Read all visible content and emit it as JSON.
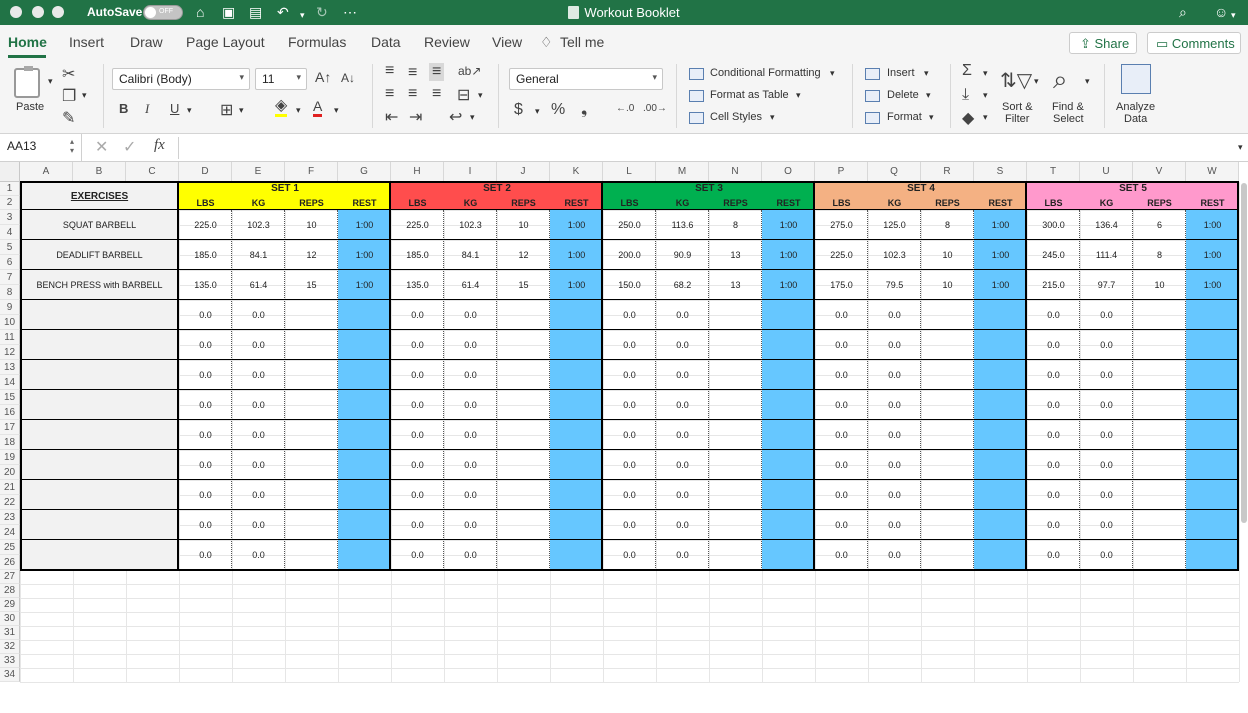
{
  "title_bar": {
    "autosave_label": "AutoSave",
    "autosave_state": "OFF",
    "document_title": "Workout Booklet"
  },
  "tabs": [
    {
      "label": "Home",
      "active": true
    },
    {
      "label": "Insert"
    },
    {
      "label": "Draw"
    },
    {
      "label": "Page Layout"
    },
    {
      "label": "Formulas"
    },
    {
      "label": "Data"
    },
    {
      "label": "Review"
    },
    {
      "label": "View"
    }
  ],
  "tell_me": "Tell me",
  "share_label": "Share",
  "comments_label": "Comments",
  "ribbon": {
    "paste": "Paste",
    "font_name": "Calibri (Body)",
    "font_size": "11",
    "number_format": "General",
    "conditional_formatting": "Conditional Formatting",
    "format_as_table": "Format as Table",
    "cell_styles": "Cell Styles",
    "insert": "Insert",
    "delete": "Delete",
    "format": "Format",
    "sort_filter_1": "Sort &",
    "sort_filter_2": "Filter",
    "find_select_1": "Find &",
    "find_select_2": "Select",
    "analyze_data_1": "Analyze",
    "analyze_data_2": "Data"
  },
  "formula_bar": {
    "cell_ref": "AA13",
    "fx": "fx",
    "value": ""
  },
  "columns": [
    "A",
    "B",
    "C",
    "D",
    "E",
    "F",
    "G",
    "H",
    "I",
    "J",
    "K",
    "L",
    "M",
    "N",
    "O",
    "P",
    "Q",
    "R",
    "S",
    "T",
    "U",
    "V",
    "W"
  ],
  "rows": [
    "1",
    "2",
    "3",
    "4",
    "5",
    "6",
    "7",
    "8",
    "9",
    "10",
    "11",
    "12",
    "13",
    "14",
    "15",
    "16",
    "17",
    "18",
    "19",
    "20",
    "21",
    "22",
    "23",
    "24",
    "25",
    "26",
    "27",
    "28",
    "29",
    "30",
    "31",
    "32",
    "33",
    "34"
  ],
  "exercises_header": "EXERCISES",
  "sets": [
    {
      "title": "SET 1",
      "color": "#ffff00"
    },
    {
      "title": "SET 2",
      "color": "#ff4d4d"
    },
    {
      "title": "SET 3",
      "color": "#00b050"
    },
    {
      "title": "SET 4",
      "color": "#f4b183"
    },
    {
      "title": "SET 5",
      "color": "#ff99cc"
    }
  ],
  "sub_headers": [
    "LBS",
    "KG",
    "REPS",
    "REST"
  ],
  "rest_color": "#66c7ff",
  "exercises": [
    {
      "name": "SQUAT BARBELL",
      "sets": [
        [
          "225.0",
          "102.3",
          "10",
          "1:00"
        ],
        [
          "225.0",
          "102.3",
          "10",
          "1:00"
        ],
        [
          "250.0",
          "113.6",
          "8",
          "1:00"
        ],
        [
          "275.0",
          "125.0",
          "8",
          "1:00"
        ],
        [
          "300.0",
          "136.4",
          "6",
          "1:00"
        ]
      ]
    },
    {
      "name": "DEADLIFT BARBELL",
      "sets": [
        [
          "185.0",
          "84.1",
          "12",
          "1:00"
        ],
        [
          "185.0",
          "84.1",
          "12",
          "1:00"
        ],
        [
          "200.0",
          "90.9",
          "13",
          "1:00"
        ],
        [
          "225.0",
          "102.3",
          "10",
          "1:00"
        ],
        [
          "245.0",
          "111.4",
          "8",
          "1:00"
        ]
      ]
    },
    {
      "name": "BENCH PRESS with BARBELL",
      "sets": [
        [
          "135.0",
          "61.4",
          "15",
          "1:00"
        ],
        [
          "135.0",
          "61.4",
          "15",
          "1:00"
        ],
        [
          "150.0",
          "68.2",
          "13",
          "1:00"
        ],
        [
          "175.0",
          "79.5",
          "10",
          "1:00"
        ],
        [
          "215.0",
          "97.7",
          "10",
          "1:00"
        ]
      ]
    },
    {
      "name": "",
      "sets": [
        [
          "0.0",
          "0.0",
          "",
          ""
        ],
        [
          "0.0",
          "0.0",
          "",
          ""
        ],
        [
          "0.0",
          "0.0",
          "",
          ""
        ],
        [
          "0.0",
          "0.0",
          "",
          ""
        ],
        [
          "0.0",
          "0.0",
          "",
          ""
        ]
      ]
    },
    {
      "name": "",
      "sets": [
        [
          "0.0",
          "0.0",
          "",
          ""
        ],
        [
          "0.0",
          "0.0",
          "",
          ""
        ],
        [
          "0.0",
          "0.0",
          "",
          ""
        ],
        [
          "0.0",
          "0.0",
          "",
          ""
        ],
        [
          "0.0",
          "0.0",
          "",
          ""
        ]
      ]
    },
    {
      "name": "",
      "sets": [
        [
          "0.0",
          "0.0",
          "",
          ""
        ],
        [
          "0.0",
          "0.0",
          "",
          ""
        ],
        [
          "0.0",
          "0.0",
          "",
          ""
        ],
        [
          "0.0",
          "0.0",
          "",
          ""
        ],
        [
          "0.0",
          "0.0",
          "",
          ""
        ]
      ]
    },
    {
      "name": "",
      "sets": [
        [
          "0.0",
          "0.0",
          "",
          ""
        ],
        [
          "0.0",
          "0.0",
          "",
          ""
        ],
        [
          "0.0",
          "0.0",
          "",
          ""
        ],
        [
          "0.0",
          "0.0",
          "",
          ""
        ],
        [
          "0.0",
          "0.0",
          "",
          ""
        ]
      ]
    },
    {
      "name": "",
      "sets": [
        [
          "0.0",
          "0.0",
          "",
          ""
        ],
        [
          "0.0",
          "0.0",
          "",
          ""
        ],
        [
          "0.0",
          "0.0",
          "",
          ""
        ],
        [
          "0.0",
          "0.0",
          "",
          ""
        ],
        [
          "0.0",
          "0.0",
          "",
          ""
        ]
      ]
    },
    {
      "name": "",
      "sets": [
        [
          "0.0",
          "0.0",
          "",
          ""
        ],
        [
          "0.0",
          "0.0",
          "",
          ""
        ],
        [
          "0.0",
          "0.0",
          "",
          ""
        ],
        [
          "0.0",
          "0.0",
          "",
          ""
        ],
        [
          "0.0",
          "0.0",
          "",
          ""
        ]
      ]
    },
    {
      "name": "",
      "sets": [
        [
          "0.0",
          "0.0",
          "",
          ""
        ],
        [
          "0.0",
          "0.0",
          "",
          ""
        ],
        [
          "0.0",
          "0.0",
          "",
          ""
        ],
        [
          "0.0",
          "0.0",
          "",
          ""
        ],
        [
          "0.0",
          "0.0",
          "",
          ""
        ]
      ]
    },
    {
      "name": "",
      "sets": [
        [
          "0.0",
          "0.0",
          "",
          ""
        ],
        [
          "0.0",
          "0.0",
          "",
          ""
        ],
        [
          "0.0",
          "0.0",
          "",
          ""
        ],
        [
          "0.0",
          "0.0",
          "",
          ""
        ],
        [
          "0.0",
          "0.0",
          "",
          ""
        ]
      ]
    },
    {
      "name": "",
      "sets": [
        [
          "0.0",
          "0.0",
          "",
          ""
        ],
        [
          "0.0",
          "0.0",
          "",
          ""
        ],
        [
          "0.0",
          "0.0",
          "",
          ""
        ],
        [
          "0.0",
          "0.0",
          "",
          ""
        ],
        [
          "0.0",
          "0.0",
          "",
          ""
        ]
      ]
    }
  ]
}
